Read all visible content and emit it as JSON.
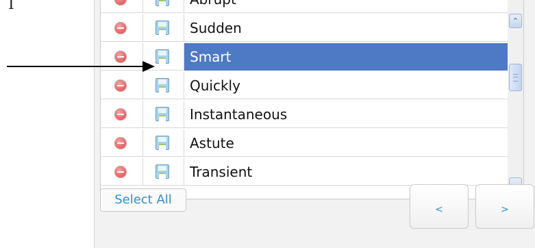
{
  "top_glyph": "I",
  "list": {
    "items": [
      {
        "label": "Abrupt",
        "selected": false
      },
      {
        "label": "Sudden",
        "selected": false
      },
      {
        "label": "Smart",
        "selected": true
      },
      {
        "label": "Quickly",
        "selected": false
      },
      {
        "label": "Instantaneous",
        "selected": false
      },
      {
        "label": "Astute",
        "selected": false
      },
      {
        "label": "Transient",
        "selected": false
      }
    ]
  },
  "scrollbar": {
    "up_glyph": "⌃",
    "down_glyph": "⌄"
  },
  "footer": {
    "select_all_label": "Select All",
    "prev_label": "<",
    "next_label": ">"
  },
  "colors": {
    "selection": "#4e79c4",
    "link": "#2e8fd0",
    "tab_green": "#3dbb3d"
  },
  "icons": {
    "delete": "minus-circle-icon",
    "save": "floppy-disk-icon"
  }
}
